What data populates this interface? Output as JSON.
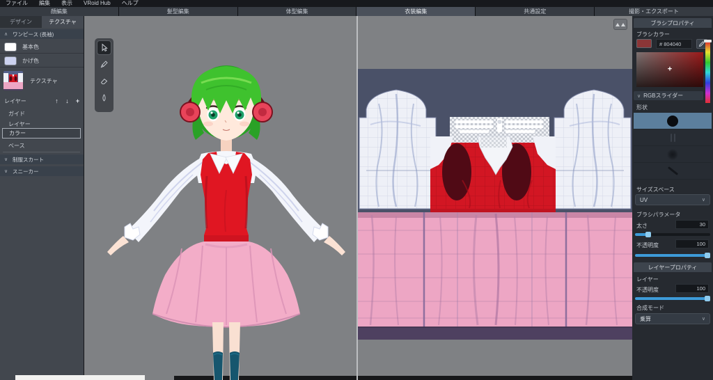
{
  "menubar": {
    "items": [
      {
        "label": "ファイル"
      },
      {
        "label": "編集"
      },
      {
        "label": "表示"
      },
      {
        "label": "VRoid Hub"
      },
      {
        "label": "ヘルプ"
      }
    ]
  },
  "tabbar": {
    "tabs": [
      {
        "label": "顔編集",
        "active": false
      },
      {
        "label": "髪型編集",
        "active": false
      },
      {
        "label": "体型編集",
        "active": false
      },
      {
        "label": "衣装編集",
        "active": true
      },
      {
        "label": "共通設定",
        "active": false
      },
      {
        "label": "撮影・エクスポート",
        "active": false
      }
    ]
  },
  "icons": {
    "collapse": "∧",
    "expand": "∨",
    "dropdown": "∨",
    "up": "↑",
    "down": "↓",
    "add": "+",
    "plus_cursor": "+"
  },
  "left_panel": {
    "tabs": [
      {
        "label": "デザイン",
        "active": false
      },
      {
        "label": "テクスチャ",
        "active": true
      }
    ],
    "section_header": "ワンピース (長袖)",
    "color_rows": [
      {
        "label": "基本色",
        "swatch": "#ffffff"
      },
      {
        "label": "かげ色",
        "swatch": "#ccd2ef"
      }
    ],
    "texture_row_label": "テクスチャ",
    "layer_header_label": "レイヤー",
    "layer_items": [
      {
        "label": "ガイド",
        "selected": false
      },
      {
        "label": "レイヤー",
        "selected": false
      },
      {
        "label": "カラー",
        "selected": true
      },
      {
        "label": "ベース",
        "selected": false
      }
    ],
    "collapsed_sections": [
      {
        "label": "制服スカート"
      },
      {
        "label": "スニーカー"
      }
    ]
  },
  "viewport": {
    "tools": [
      {
        "name": "select",
        "selected": true
      },
      {
        "name": "brush",
        "selected": false
      },
      {
        "name": "eraser",
        "selected": false
      },
      {
        "name": "fill",
        "selected": false
      }
    ]
  },
  "right_panel": {
    "brush_props_title": "ブラシプロパティ",
    "brush_color_label": "ブラシカラー",
    "hex_value": "# 804040",
    "rgb_slider_header": "RGBスライダー",
    "shape_label": "形状",
    "shape_options": [
      {
        "name": "hard-circle",
        "selected": true
      },
      {
        "name": "pen-tip",
        "selected": false
      },
      {
        "name": "soft-circle",
        "selected": false
      },
      {
        "name": "diagonal-stroke",
        "selected": false
      }
    ],
    "size_space_label": "サイズスペース",
    "size_space_value": "UV",
    "brush_params_label": "ブラシパラメータ",
    "thickness_label": "太さ",
    "thickness_value": "30",
    "opacity_label": "不透明度",
    "opacity_value": "100",
    "layer_props_title": "レイヤープロパティ",
    "layer_label": "レイヤー",
    "layer_opacity_label": "不透明度",
    "layer_opacity_value": "100",
    "blend_mode_label": "合成モード",
    "blend_mode_value": "乗算"
  },
  "colors": {
    "accent_blue": "#3d9bd9",
    "brush_color": "#804040",
    "texture_background": "#4a5168",
    "skirt_pink": "#eda6c4",
    "bodice_red": "#d21623",
    "viewport_gray": "#7f8184"
  }
}
